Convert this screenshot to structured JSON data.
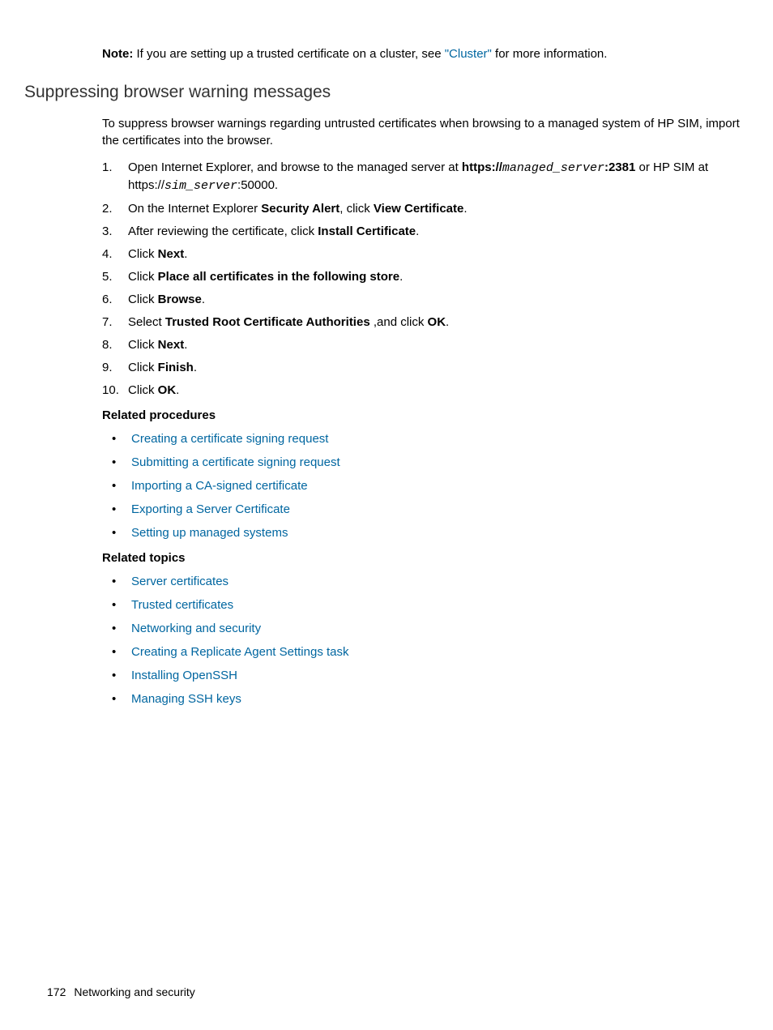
{
  "note": {
    "label": "Note:",
    "text_before": " If you are setting up a trusted certificate on a cluster, see ",
    "link": "\"Cluster\"",
    "text_after": " for more information."
  },
  "heading": "Suppressing browser warning messages",
  "intro": "To suppress browser warnings regarding untrusted certificates when browsing to a managed system of HP SIM, import the certificates into the browser.",
  "steps": {
    "s1_a": "Open Internet Explorer, and browse to the managed server at ",
    "s1_b": "https://",
    "s1_c": "managed_server",
    "s1_d": ":2381",
    "s1_e": " or HP SIM at https://",
    "s1_f": "sim_server",
    "s1_g": ":50000.",
    "s2_a": "On the Internet Explorer ",
    "s2_b": "Security Alert",
    "s2_c": ", click ",
    "s2_d": "View Certificate",
    "s2_e": ".",
    "s3_a": "After reviewing the certificate, click ",
    "s3_b": "Install Certificate",
    "s3_c": ".",
    "s4_a": "Click ",
    "s4_b": "Next",
    "s4_c": ".",
    "s5_a": "Click ",
    "s5_b": "Place all certificates in the following store",
    "s5_c": ".",
    "s6_a": "Click ",
    "s6_b": "Browse",
    "s6_c": ".",
    "s7_a": "Select ",
    "s7_b": "Trusted Root Certificate Authorities",
    "s7_c": " ,and click ",
    "s7_d": "OK",
    "s7_e": ".",
    "s8_a": "Click ",
    "s8_b": "Next",
    "s8_c": ".",
    "s9_a": "Click ",
    "s9_b": "Finish",
    "s9_c": ".",
    "s10_a": "Click ",
    "s10_b": "OK",
    "s10_c": "."
  },
  "related_procedures_label": "Related procedures",
  "related_procedures": {
    "p0": "Creating a certificate signing request",
    "p1": "Submitting a certificate signing request",
    "p2": "Importing a CA-signed certificate",
    "p3": "Exporting a Server Certificate",
    "p4": "Setting up managed systems"
  },
  "related_topics_label": "Related topics",
  "related_topics": {
    "t0": "Server certificates",
    "t1": "Trusted certificates",
    "t2": "Networking and security",
    "t3": "Creating a Replicate Agent Settings task",
    "t4": "Installing OpenSSH",
    "t5": "Managing SSH keys"
  },
  "footer": {
    "page": "172",
    "section": "Networking and security"
  }
}
